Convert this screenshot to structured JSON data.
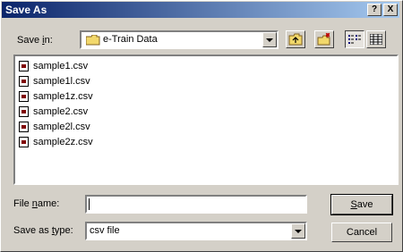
{
  "window": {
    "title": "Save As"
  },
  "titlebar": {
    "help": "?",
    "close": "X"
  },
  "save_in": {
    "label_pre": "Save ",
    "label_u": "i",
    "label_post": "n:",
    "folder": "e-Train Data"
  },
  "files": [
    "sample1.csv",
    "sample1l.csv",
    "sample1z.csv",
    "sample2.csv",
    "sample2l.csv",
    "sample2z.csv"
  ],
  "filename": {
    "label_pre": "File ",
    "label_u": "n",
    "label_post": "ame:",
    "value": ""
  },
  "filetype": {
    "label_pre": "Save as ",
    "label_u": "t",
    "label_post": "ype:",
    "value": "csv file"
  },
  "buttons": {
    "save_u": "S",
    "save_rest": "ave",
    "cancel": "Cancel"
  },
  "icons": [
    "folder-icon",
    "up-folder-icon",
    "new-folder-icon",
    "list-view-icon",
    "details-view-icon",
    "csv-file-icon"
  ]
}
